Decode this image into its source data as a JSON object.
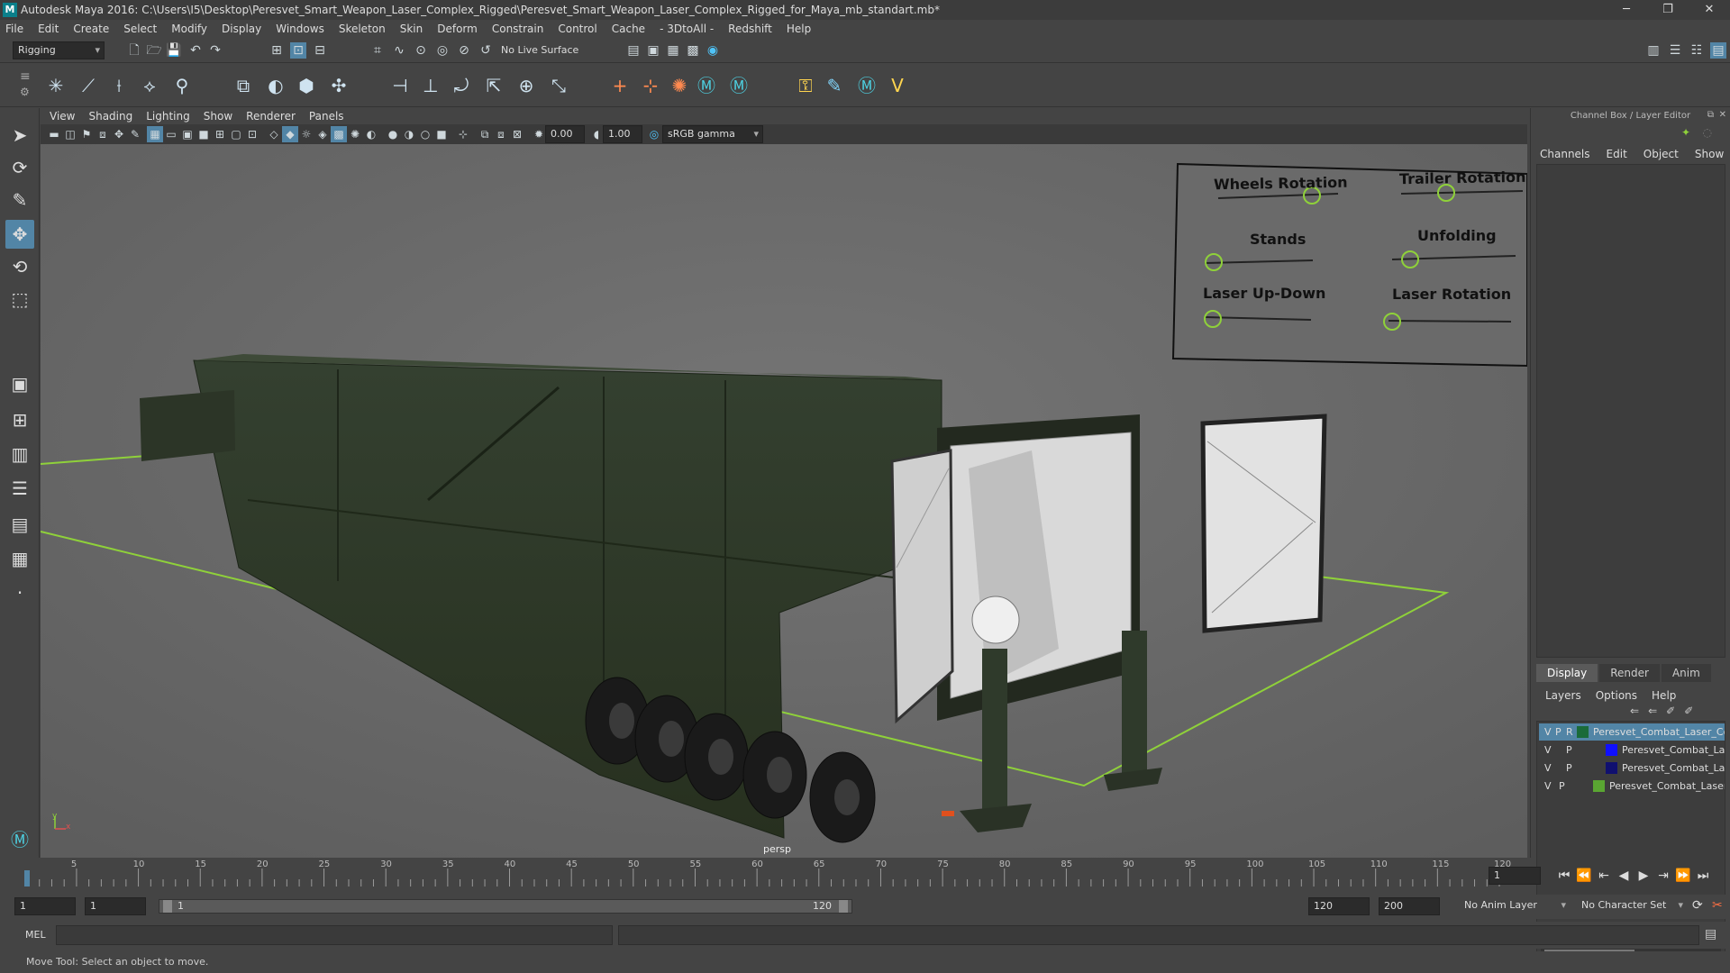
{
  "window": {
    "title": "Autodesk Maya 2016: C:\\Users\\I5\\Desktop\\Peresvet_Smart_Weapon_Laser_Complex_Rigged\\Peresvet_Smart_Weapon_Laser_Complex_Rigged_for_Maya_mb_standart.mb*",
    "minimize": "─",
    "maximize": "❐",
    "close": "✕"
  },
  "menubar": {
    "items": [
      "File",
      "Edit",
      "Create",
      "Select",
      "Modify",
      "Display",
      "Windows",
      "Skeleton",
      "Skin",
      "Deform",
      "Constrain",
      "Control",
      "Cache",
      "- 3DtoAll -",
      "Redshift",
      "Help"
    ]
  },
  "statusline": {
    "menuset": "Rigging",
    "live_surface": "No Live Surface"
  },
  "panel": {
    "menus": [
      "View",
      "Shading",
      "Lighting",
      "Show",
      "Renderer",
      "Panels"
    ],
    "near_value": "0.00",
    "far_value": "1.00",
    "color_space": "sRGB gamma",
    "camera_label": "persp",
    "axis_y": "y",
    "axis_x": "x"
  },
  "control_board": {
    "labels": [
      "Wheels Rotation",
      "Trailer Rotation",
      "Stands",
      "Unfolding",
      "Laser Up-Down",
      "Laser Rotation"
    ]
  },
  "channelbox": {
    "header": "Channel Box / Layer Editor",
    "menus": [
      "Channels",
      "Edit",
      "Object",
      "Show"
    ],
    "layer_tabs": [
      "Display",
      "Render",
      "Anim"
    ],
    "layer_menus": [
      "Layers",
      "Options",
      "Help"
    ],
    "layers": [
      {
        "v": "V",
        "p": "P",
        "r": "R",
        "name": "Peresvet_Combat_Laser_Com",
        "color": "#1a6b3a",
        "selected": true
      },
      {
        "v": "V",
        "p": "P",
        "r": "",
        "name": "Peresvet_Combat_Laser_",
        "color": "#1010ff",
        "selected": false
      },
      {
        "v": "V",
        "p": "P",
        "r": "",
        "name": "Peresvet_Combat_Laser_",
        "color": "#101070",
        "selected": false
      },
      {
        "v": "V",
        "p": "P",
        "r": "",
        "name": "Peresvet_Combat_Laser_C",
        "color": "#5aa632",
        "selected": false
      }
    ]
  },
  "timeline": {
    "ticks": [
      "1",
      "5",
      "10",
      "15",
      "20",
      "25",
      "30",
      "35",
      "40",
      "45",
      "50",
      "55",
      "60",
      "65",
      "70",
      "75",
      "80",
      "85",
      "90",
      "95",
      "100",
      "105",
      "110",
      "115",
      "120"
    ],
    "current_frame": "1",
    "range_start": "1",
    "range_inner_start": "1",
    "slider_start": "1",
    "slider_end": "120",
    "range_end": "120",
    "anim_end": "200",
    "anim_layer": "No Anim Layer",
    "character_set": "No Character Set"
  },
  "commandline": {
    "label": "MEL"
  },
  "helpline": {
    "text": "Move Tool: Select an object to move."
  },
  "colors": {
    "accent": "#5285a6",
    "grid": "#8fd13a",
    "vehicle": "#2f3a2b"
  }
}
